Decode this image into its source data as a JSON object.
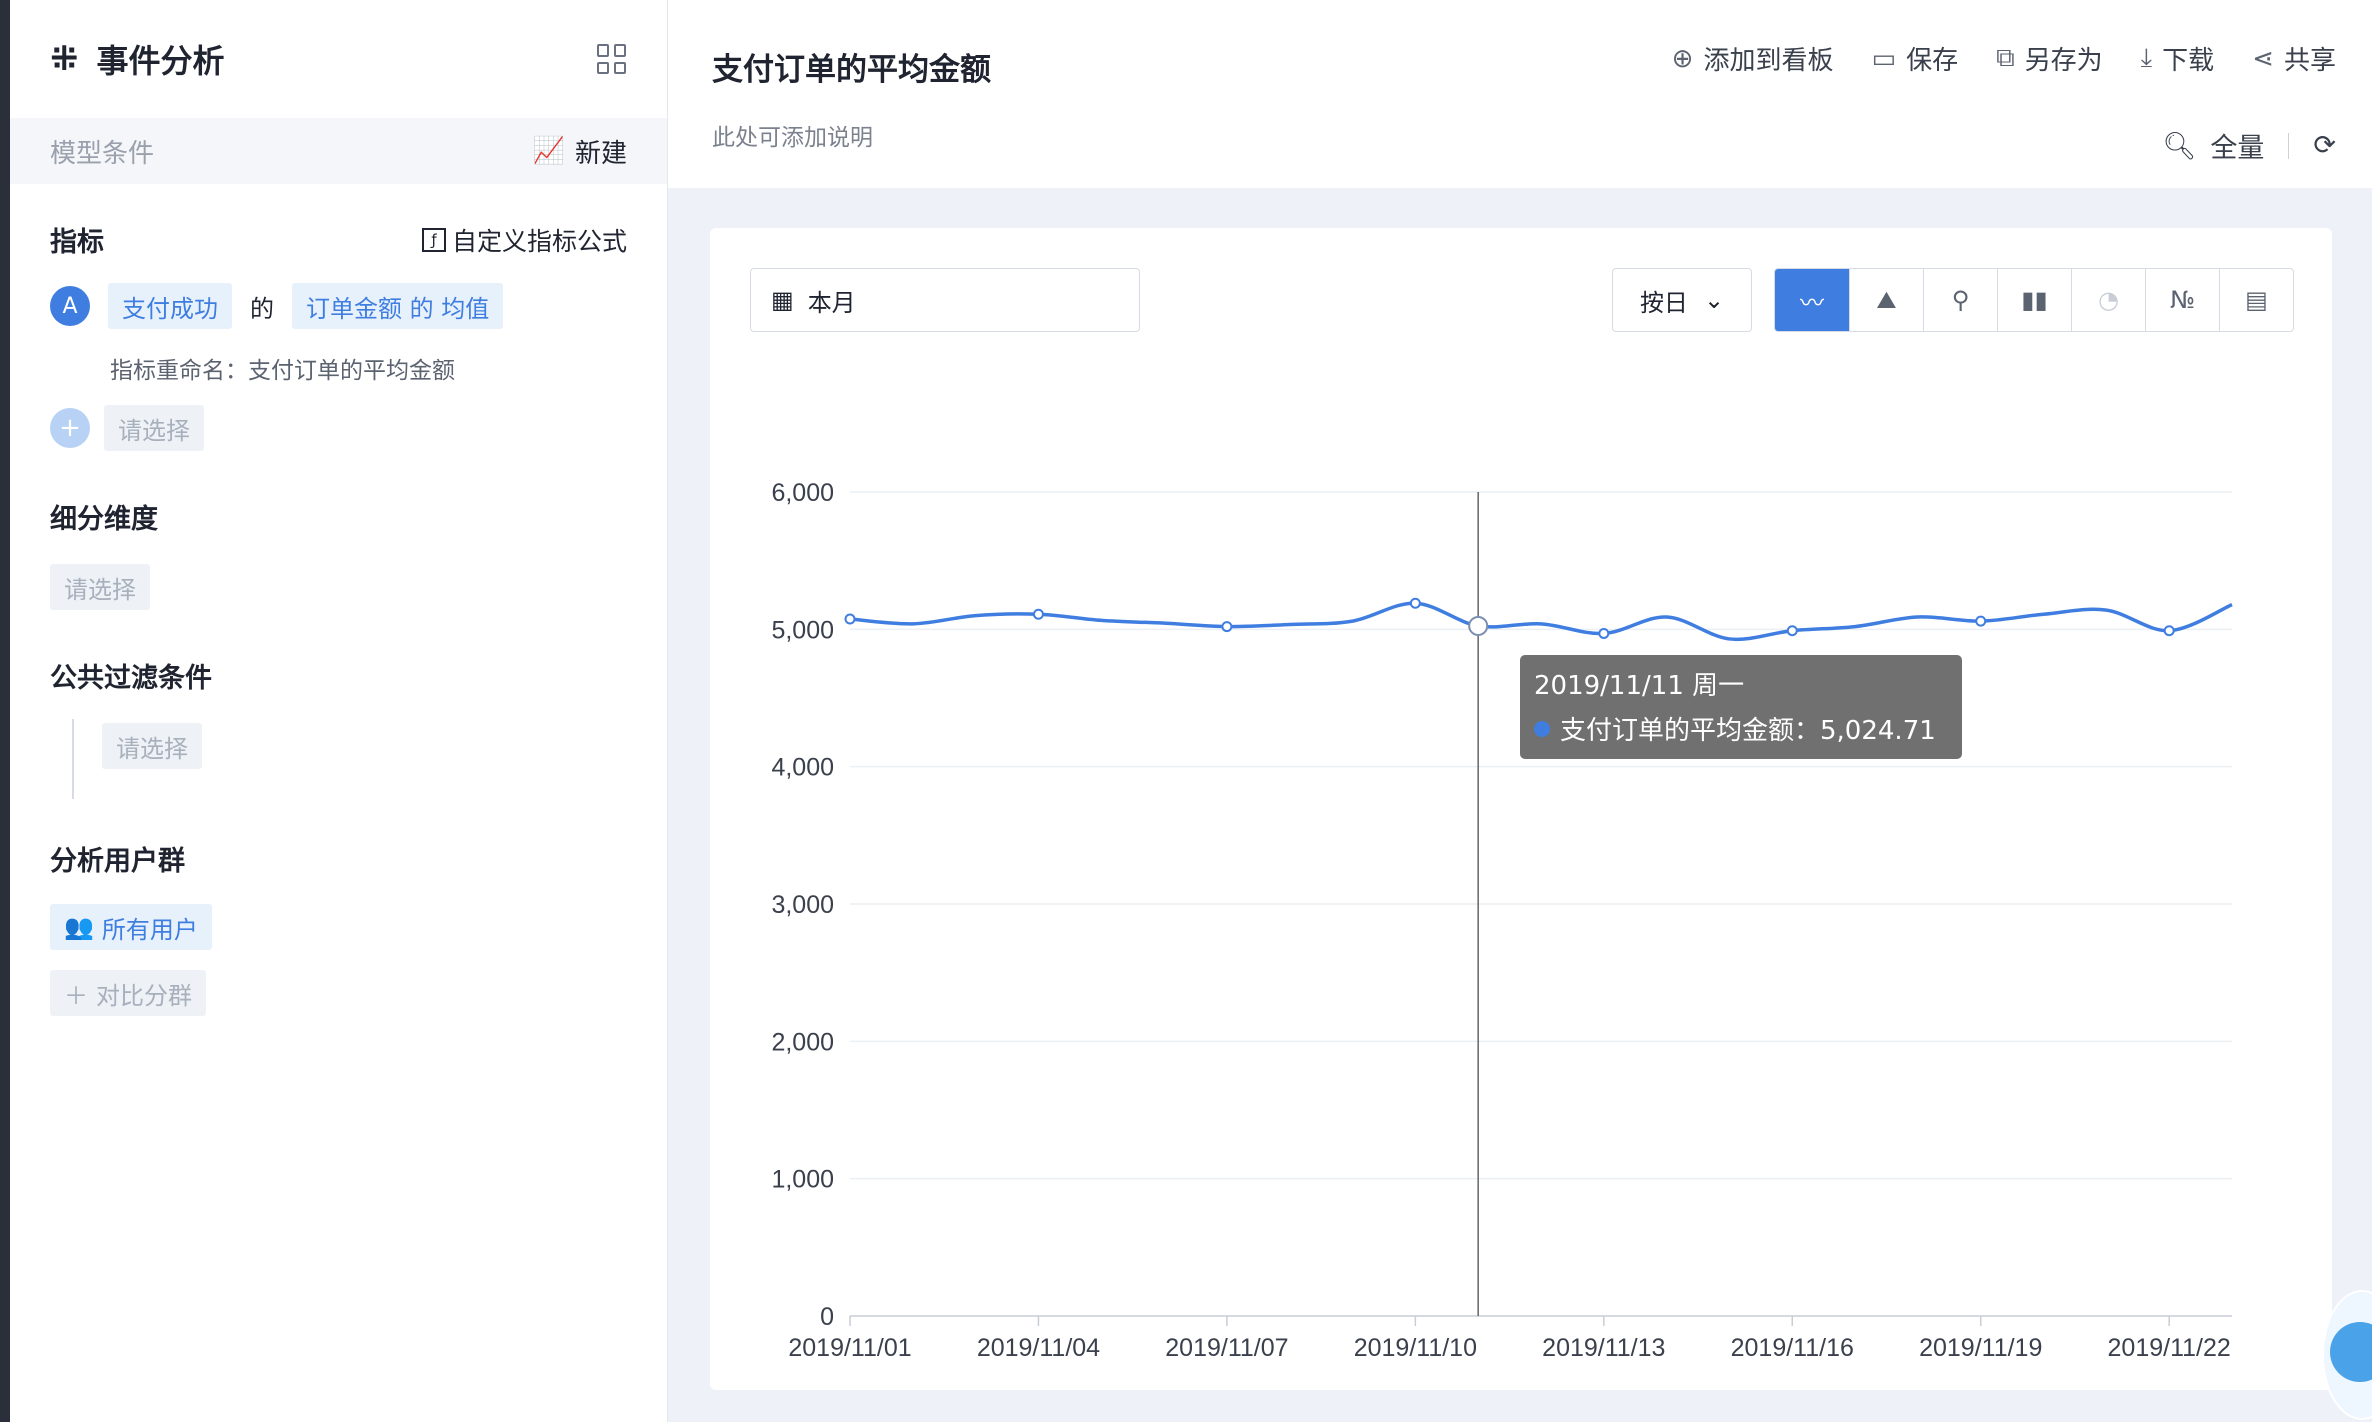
{
  "app": {
    "title": "事件分析"
  },
  "sidebar": {
    "model_label": "模型条件",
    "new_label": "新建",
    "metrics": {
      "title": "指标",
      "custom_formula": "自定义指标公式",
      "badge": "A",
      "event": "支付成功",
      "of": "的",
      "property": "订单金额 的 均值",
      "rename": "指标重命名：支付订单的平均金额",
      "add_placeholder": "请选择"
    },
    "dimension": {
      "title": "细分维度",
      "placeholder": "请选择"
    },
    "filter": {
      "title": "公共过滤条件",
      "placeholder": "请选择"
    },
    "users": {
      "title": "分析用户群",
      "all_users": "所有用户",
      "compare": "对比分群"
    }
  },
  "header": {
    "title": "支付订单的平均金额",
    "description": "此处可添加说明",
    "toolbar": [
      {
        "label": "添加到看板",
        "icon": "add-board-icon"
      },
      {
        "label": "保存",
        "icon": "save-icon"
      },
      {
        "label": "另存为",
        "icon": "save-as-icon"
      },
      {
        "label": "下载",
        "icon": "download-icon"
      },
      {
        "label": "共享",
        "icon": "share-icon"
      }
    ],
    "scope_label": "全量"
  },
  "controls": {
    "date_range": "本月",
    "granularity": "按日",
    "chart_types": [
      "line",
      "area",
      "funnel",
      "bar",
      "pie",
      "number",
      "table"
    ],
    "active_chart_type": "line",
    "number_type_label": "№"
  },
  "tooltip": {
    "date": "2019/11/11 周一",
    "series_label": "支付订单的平均金额：5,024.71"
  },
  "colors": {
    "accent": "#3f7ee0"
  },
  "chart_data": {
    "type": "line",
    "series": [
      {
        "x": [
          "2019/11/01",
          "2019/11/02",
          "2019/11/03",
          "2019/11/04",
          "2019/11/05",
          "2019/11/06",
          "2019/11/07",
          "2019/11/08",
          "2019/11/09",
          "2019/11/10",
          "2019/11/11",
          "2019/11/12",
          "2019/11/13",
          "2019/11/14",
          "2019/11/15",
          "2019/11/16",
          "2019/11/17",
          "2019/11/18",
          "2019/11/19",
          "2019/11/20",
          "2019/11/21",
          "2019/11/22",
          "2019/11/23"
        ],
        "values": [
          5075,
          5040,
          5100,
          5110,
          5065,
          5045,
          5020,
          5035,
          5060,
          5190,
          5024.71,
          5040,
          4970,
          5090,
          4930,
          4990,
          5020,
          5090,
          5060,
          5110,
          5140,
          4990,
          5180
        ]
      }
    ],
    "x_tick_labels": [
      "2019/11/01",
      "2019/11/04",
      "2019/11/07",
      "2019/11/10",
      "2019/11/13",
      "2019/11/16",
      "2019/11/19",
      "2019/11/22"
    ],
    "y_tick_labels": [
      "0",
      "1,000",
      "2,000",
      "3,000",
      "4,000",
      "5,000",
      "6,000"
    ],
    "ylim": [
      0,
      6000
    ],
    "marked_points": [
      0,
      3,
      6,
      9,
      10,
      12,
      15,
      18,
      21
    ],
    "highlight_index": 10,
    "grid": true
  }
}
